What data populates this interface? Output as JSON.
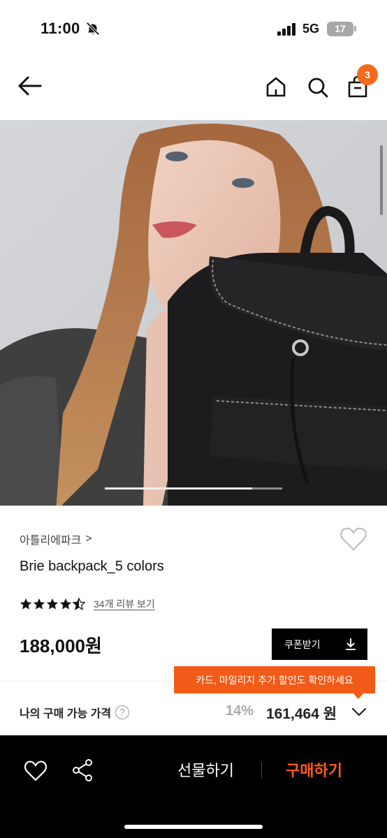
{
  "status_bar": {
    "time": "11:00",
    "network": "5G",
    "battery": "17"
  },
  "nav": {
    "cart_count": "3"
  },
  "hero": {
    "page_progress": 0.83
  },
  "product": {
    "brand": "아틀리에파크",
    "brand_chevron": ">",
    "title": "Brie backpack_5 colors",
    "rating": 4.5,
    "review_link": "34개 리뷰 보기",
    "price": "188,000원",
    "coupon_label": "쿠폰받기"
  },
  "tooltip": {
    "text": "카드, 마일리지 추가 할인도 확인하세요"
  },
  "my_price": {
    "label": "나의 구매 가능 가격",
    "help": "?",
    "discount": "14%",
    "value": "161,464 원"
  },
  "bottom_bar": {
    "gift_label": "선물하기",
    "buy_label": "구매하기"
  },
  "colors": {
    "accent": "#f25b17",
    "buy": "#ff5a1f"
  },
  "icons": [
    "bell-slash-icon",
    "signal-icon",
    "back-arrow-icon",
    "home-icon",
    "search-icon",
    "cart-icon",
    "heart-icon",
    "star-icon",
    "download-icon",
    "chevron-down-icon",
    "share-icon"
  ]
}
